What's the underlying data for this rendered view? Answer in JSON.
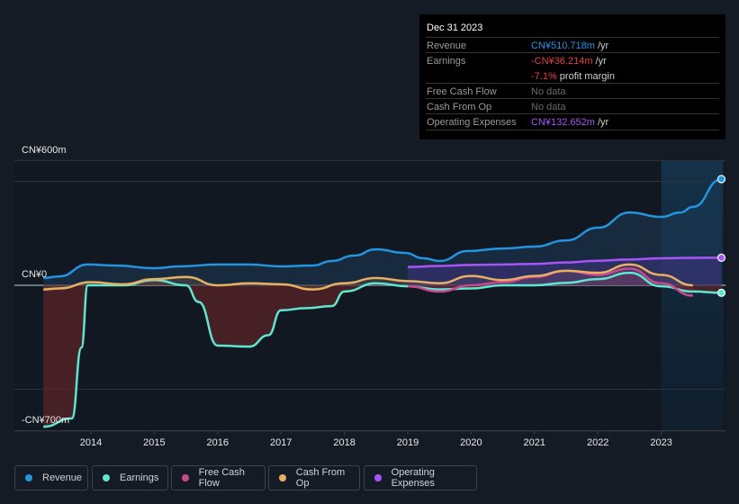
{
  "tooltip": {
    "date": "Dec 31 2023",
    "rows": [
      {
        "label": "Revenue",
        "value": "CN¥510.718m",
        "unit": " /yr",
        "color": "#2394df"
      },
      {
        "label": "Earnings",
        "value": "-CN¥36.214m",
        "unit": " /yr",
        "color": "#e64141",
        "sub_value": "-7.1%",
        "sub_text": " profit margin"
      },
      {
        "label": "Free Cash Flow",
        "value": "No data"
      },
      {
        "label": "Cash From Op",
        "value": "No data"
      },
      {
        "label": "Operating Expenses",
        "value": "CN¥132.652m",
        "unit": " /yr",
        "color": "#a855f7"
      }
    ]
  },
  "legend": [
    {
      "label": "Revenue",
      "color": "#2394df"
    },
    {
      "label": "Earnings",
      "color": "#5ee6d0"
    },
    {
      "label": "Free Cash Flow",
      "color": "#c94a8c"
    },
    {
      "label": "Cash From Op",
      "color": "#e8b063"
    },
    {
      "label": "Operating Expenses",
      "color": "#a855f7"
    }
  ],
  "chart_data": {
    "type": "line",
    "title": "",
    "xlabel": "",
    "ylabel": "",
    "y_tick_labels": [
      "CN¥600m",
      "CN¥0",
      "-CN¥700m"
    ],
    "x_tick_labels": [
      "2014",
      "2015",
      "2016",
      "2017",
      "2018",
      "2019",
      "2020",
      "2021",
      "2022",
      "2023"
    ],
    "x_ticks": [
      2014,
      2015,
      2016,
      2017,
      2018,
      2019,
      2020,
      2021,
      2022,
      2023
    ],
    "ylim": [
      -700,
      600
    ],
    "xlim": [
      2012.72,
      2023.98
    ],
    "gridlines": [
      600,
      500,
      0,
      -500
    ],
    "unit": "CN¥ millions",
    "highlight_from": 2023.0,
    "legend_position": "bottom-left",
    "series": [
      {
        "name": "Revenue",
        "color": "#2394df",
        "x": [
          2013.25,
          2013.5,
          2013.95,
          2014.4,
          2015.0,
          2015.4,
          2016.0,
          2016.5,
          2017.0,
          2017.5,
          2017.8,
          2018.15,
          2018.5,
          2018.95,
          2019.25,
          2019.5,
          2019.95,
          2020.5,
          2021.0,
          2021.5,
          2022.0,
          2022.5,
          2023.0,
          2023.3,
          2023.5,
          2023.95
        ],
        "values": [
          35,
          43,
          100,
          95,
          82,
          91,
          100,
          100,
          91,
          95,
          117,
          143,
          173,
          156,
          130,
          117,
          165,
          177,
          186,
          216,
          277,
          350,
          329,
          350,
          377,
          511
        ]
      },
      {
        "name": "Earnings",
        "color": "#5ee6d0",
        "x": [
          2013.25,
          2013.7,
          2013.85,
          2013.95,
          2014.5,
          2015.0,
          2015.5,
          2015.7,
          2016.0,
          2016.5,
          2016.8,
          2017.0,
          2017.4,
          2017.8,
          2018.0,
          2018.5,
          2019.0,
          2019.5,
          2020.0,
          2020.5,
          2021.0,
          2021.5,
          2022.0,
          2022.5,
          2023.0,
          2023.5,
          2023.95
        ],
        "values": [
          -680,
          -640,
          -300,
          0,
          0,
          25,
          0,
          -80,
          -290,
          -295,
          -240,
          -120,
          -110,
          -100,
          -30,
          10,
          -5,
          -20,
          -15,
          0,
          0,
          12,
          30,
          60,
          -5,
          -30,
          -36
        ]
      },
      {
        "name": "Free Cash Flow",
        "color": "#c94a8c",
        "x": [
          2019.0,
          2019.5,
          2020.0,
          2020.5,
          2021.0,
          2021.5,
          2022.0,
          2022.5,
          2023.0,
          2023.5
        ],
        "values": [
          -5,
          -30,
          0,
          15,
          40,
          70,
          50,
          80,
          10,
          -50
        ]
      },
      {
        "name": "Cash From Op",
        "color": "#e8b063",
        "x": [
          2013.25,
          2013.5,
          2014.0,
          2014.5,
          2015.0,
          2015.5,
          2016.0,
          2016.5,
          2017.0,
          2017.5,
          2018.0,
          2018.5,
          2019.0,
          2019.5,
          2020.0,
          2020.5,
          2021.0,
          2021.5,
          2022.0,
          2022.5,
          2023.0,
          2023.5
        ],
        "values": [
          -20,
          -15,
          15,
          5,
          30,
          40,
          0,
          10,
          5,
          -20,
          10,
          35,
          20,
          10,
          45,
          25,
          45,
          70,
          60,
          100,
          50,
          0
        ]
      },
      {
        "name": "Operating Expenses",
        "color": "#a855f7",
        "x": [
          2019.0,
          2019.5,
          2020.0,
          2020.5,
          2021.0,
          2021.5,
          2022.0,
          2022.5,
          2023.0,
          2023.5,
          2023.95
        ],
        "values": [
          88,
          93,
          98,
          100,
          103,
          110,
          118,
          124,
          130,
          132,
          132.652
        ]
      }
    ]
  }
}
